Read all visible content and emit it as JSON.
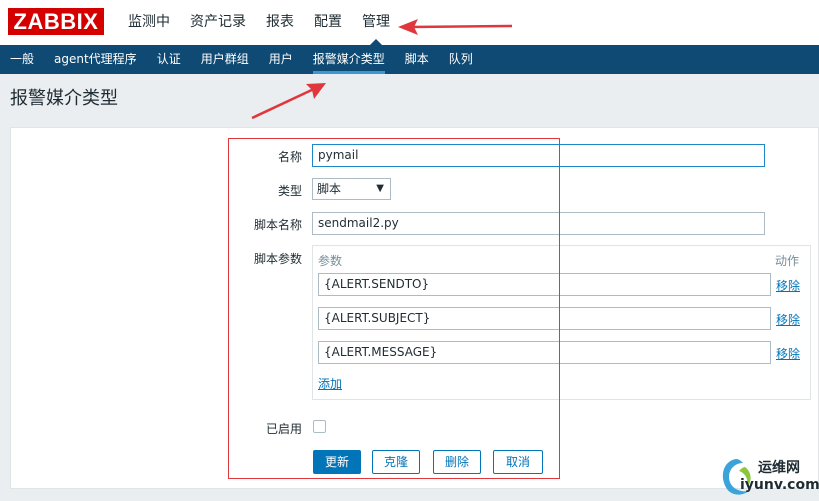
{
  "logo": {
    "text": "ZABBIX",
    "color": "#d40000"
  },
  "main_menu": [
    {
      "label": "监测中",
      "active": false
    },
    {
      "label": "资产记录",
      "active": false
    },
    {
      "label": "报表",
      "active": false
    },
    {
      "label": "配置",
      "active": false
    },
    {
      "label": "管理",
      "active": true
    }
  ],
  "sub_menu": [
    {
      "label": "一般",
      "active": false
    },
    {
      "label": "agent代理程序",
      "active": false
    },
    {
      "label": "认证",
      "active": false
    },
    {
      "label": "用户群组",
      "active": false
    },
    {
      "label": "用户",
      "active": false
    },
    {
      "label": "报警媒介类型",
      "active": true
    },
    {
      "label": "脚本",
      "active": false
    },
    {
      "label": "队列",
      "active": false
    }
  ],
  "page_title": "报警媒介类型",
  "form": {
    "name_label": "名称",
    "name_value": "pymail",
    "type_label": "类型",
    "type_value": "脚本",
    "script_name_label": "脚本名称",
    "script_name_value": "sendmail2.py",
    "script_params_label": "脚本参数",
    "params_header": "参数",
    "action_header": "动作",
    "params": [
      {
        "value": "{ALERT.SENDTO}",
        "remove_label": "移除"
      },
      {
        "value": "{ALERT.SUBJECT}",
        "remove_label": "移除"
      },
      {
        "value": "{ALERT.MESSAGE}",
        "remove_label": "移除"
      }
    ],
    "add_label": "添加",
    "enabled_label": "已启用",
    "enabled_checked": false
  },
  "buttons": {
    "update": "更新",
    "clone": "克隆",
    "delete": "删除",
    "cancel": "取消"
  },
  "watermark": {
    "line1": "运维网",
    "line2": "iyunv.com"
  },
  "colors": {
    "brand": "#d40000",
    "nav": "#0e4a73",
    "accent": "#0275b8",
    "annotation": "#e0373c"
  }
}
